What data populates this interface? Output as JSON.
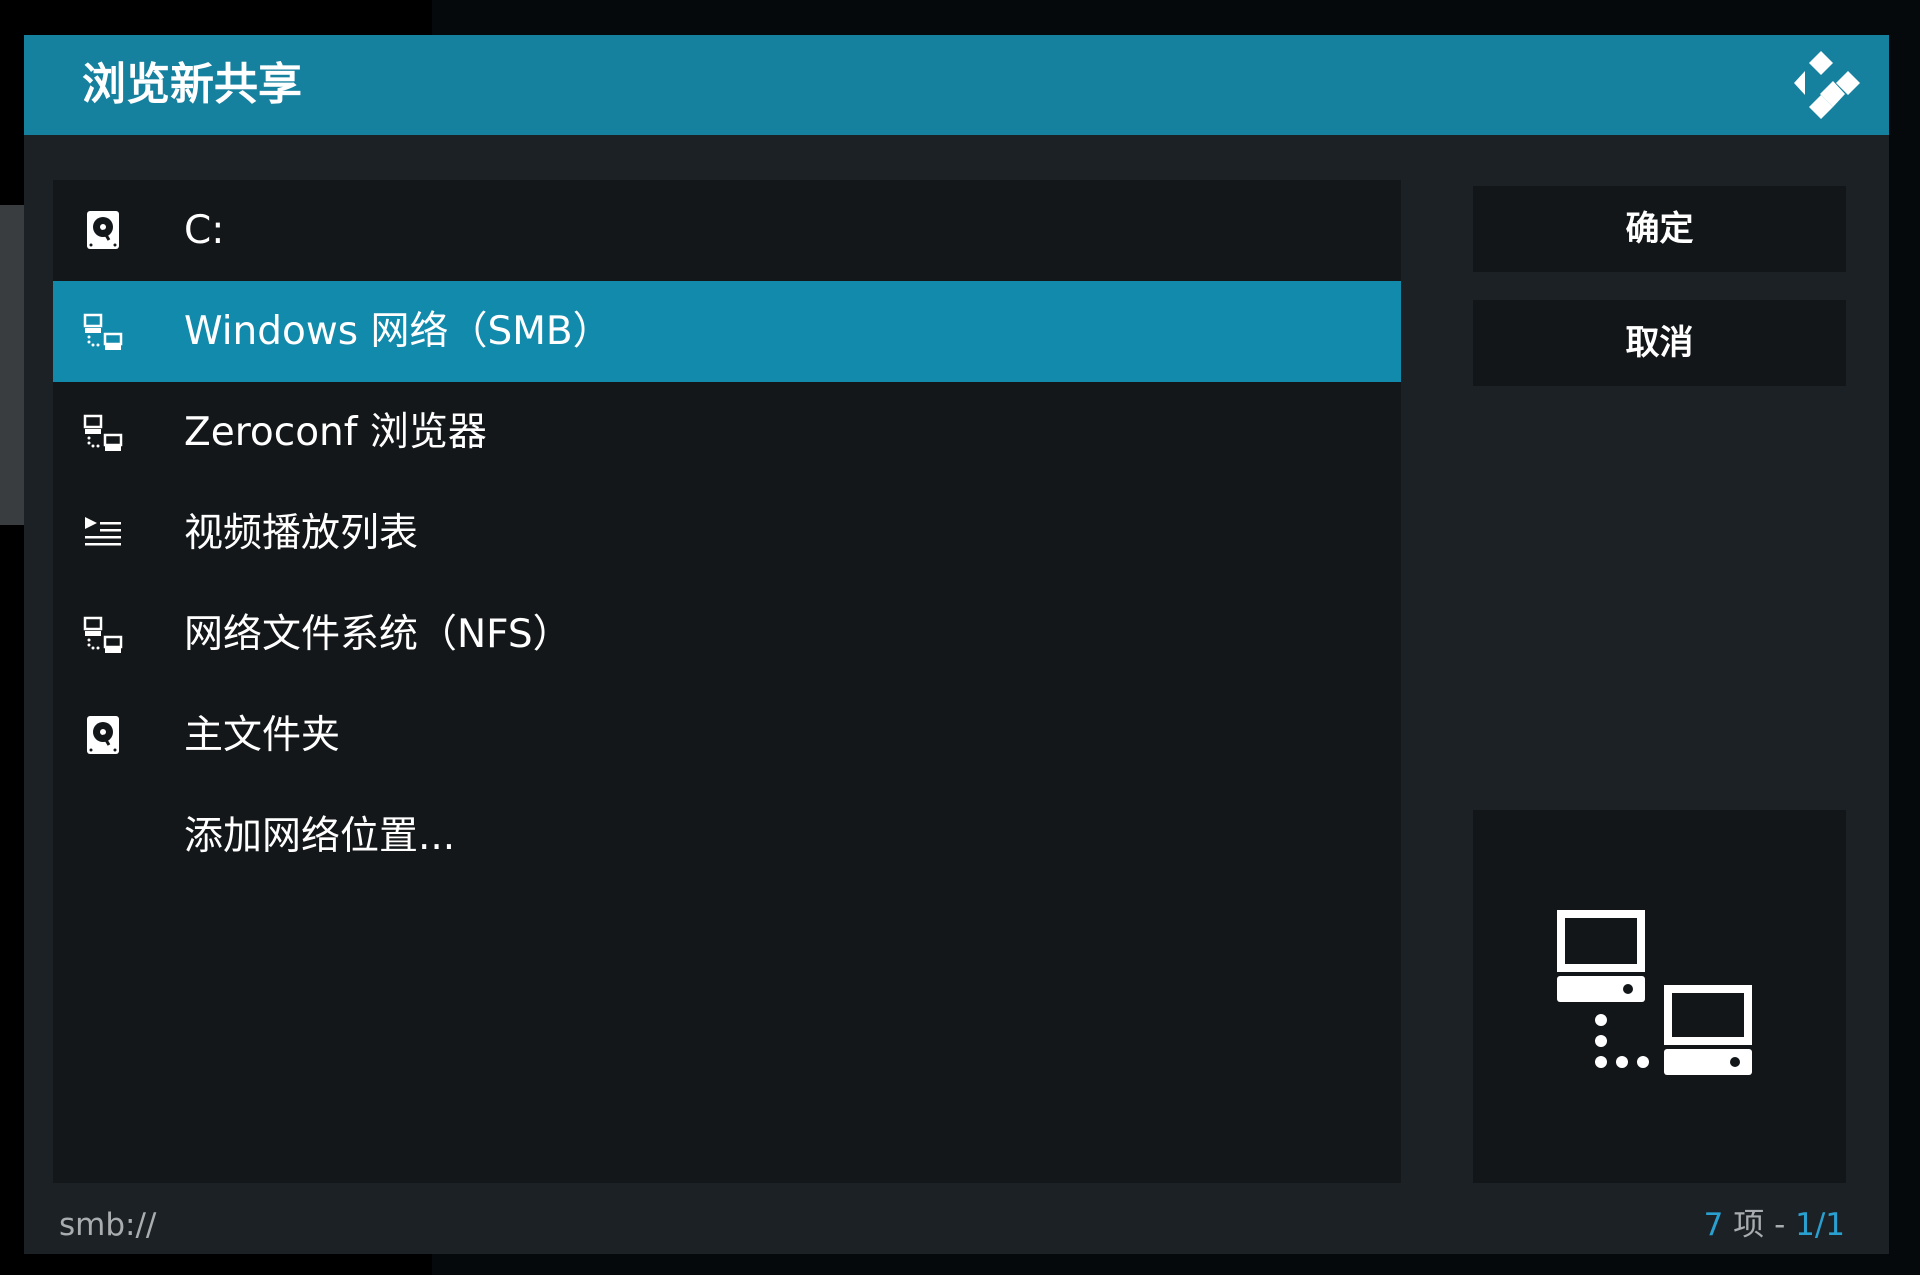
{
  "dialog": {
    "title": "浏览新共享",
    "accent_color": "#16809f"
  },
  "sources": [
    {
      "label": "C:",
      "icon": "hard-disk-icon",
      "selected": false
    },
    {
      "label": "Windows 网络（SMB）",
      "icon": "network-icon",
      "selected": true
    },
    {
      "label": "Zeroconf 浏览器",
      "icon": "network-icon",
      "selected": false
    },
    {
      "label": "视频播放列表",
      "icon": "playlist-icon",
      "selected": false
    },
    {
      "label": "网络文件系统（NFS）",
      "icon": "network-icon",
      "selected": false
    },
    {
      "label": "主文件夹",
      "icon": "hard-disk-icon",
      "selected": false
    },
    {
      "label": "添加网络位置...",
      "icon": "",
      "selected": false
    }
  ],
  "buttons": {
    "ok": "确定",
    "cancel": "取消"
  },
  "preview": {
    "icon": "network-computers-icon"
  },
  "footer": {
    "path": "smb://",
    "count_number": "7",
    "count_unit": " 项 - ",
    "page": "1/1"
  }
}
